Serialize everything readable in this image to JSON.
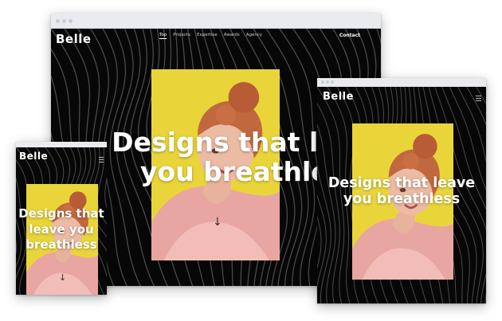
{
  "brand": {
    "logo": "Belle"
  },
  "hero": {
    "headline_line1": "Designs that leave",
    "headline_line2": "you breathless",
    "mobile_line1": "Designs that",
    "mobile_line2": "leave you",
    "mobile_line3": "breathless",
    "tablet_line1": "Designs that leave",
    "tablet_line2": "you breathless",
    "scroll_arrow": "↓"
  },
  "nav": {
    "items": [
      "Top",
      "Projects",
      "Expertise",
      "Awards",
      "Agency"
    ],
    "contact": "Contact"
  },
  "colors": {
    "background": "#070707",
    "photo_background": "#e9d53a",
    "wave_lines": "#4a4a4a",
    "jacket": "#e8a6a2",
    "text": "#ffffff"
  },
  "icons": [
    "menu-icon",
    "scroll-down-arrow-icon"
  ]
}
